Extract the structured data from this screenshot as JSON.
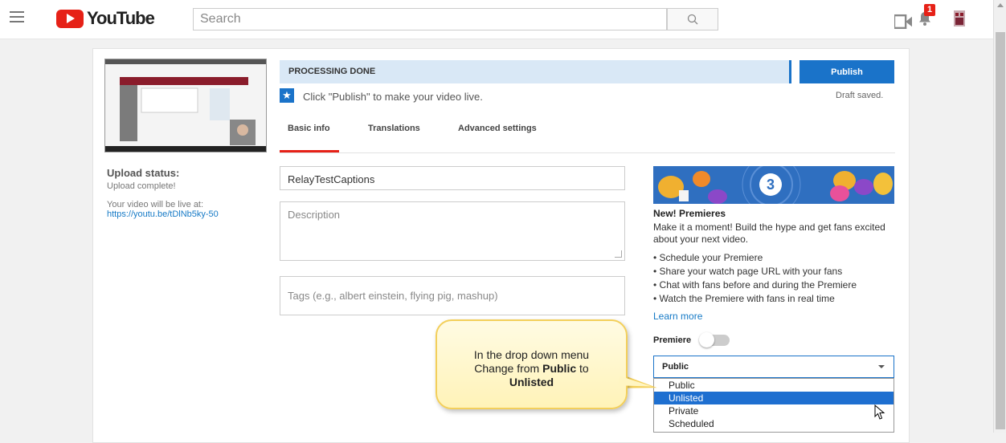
{
  "header": {
    "logo_text": "YouTube",
    "search_placeholder": "Search",
    "notification_count": "1"
  },
  "video": {
    "upload_status_heading": "Upload status:",
    "upload_status_text": "Upload complete!",
    "live_at_label": "Your video will be live at:",
    "live_url": "https://youtu.be/tDlNb5ky-50"
  },
  "status_bar": {
    "processing": "PROCESSING DONE",
    "publish_label": "Publish",
    "draft_status": "Draft saved.",
    "publish_hint": "Click \"Publish\" to make your video live."
  },
  "tabs": [
    {
      "label": "Basic info"
    },
    {
      "label": "Translations"
    },
    {
      "label": "Advanced settings"
    }
  ],
  "form": {
    "title_value": "RelayTestCaptions",
    "description_placeholder": "Description",
    "tags_placeholder": "Tags (e.g., albert einstein, flying pig, mashup)"
  },
  "premieres": {
    "banner_number": "3",
    "title": "New! Premieres",
    "description": "Make it a moment! Build the hype and get fans excited about your next video.",
    "bullets": [
      "Schedule your Premiere",
      "Share your watch page URL with your fans",
      "Chat with fans before and during the Premiere",
      "Watch the Premiere with fans in real time"
    ],
    "learn_more": "Learn more",
    "premiere_label": "Premiere"
  },
  "visibility": {
    "selected": "Public",
    "options": [
      "Public",
      "Unlisted",
      "Private",
      "Scheduled"
    ],
    "highlighted": "Unlisted"
  },
  "callout": {
    "line1": "In the drop down menu",
    "line2_prefix": "Change from ",
    "line2_bold": "Public",
    "line2_suffix": " to",
    "line3_bold": "Unlisted"
  },
  "colors": {
    "brand_red": "#e62117",
    "accent_blue": "#1a73c9",
    "processing_bg": "#d9e8f6",
    "callout_border": "#f3cf5a"
  }
}
